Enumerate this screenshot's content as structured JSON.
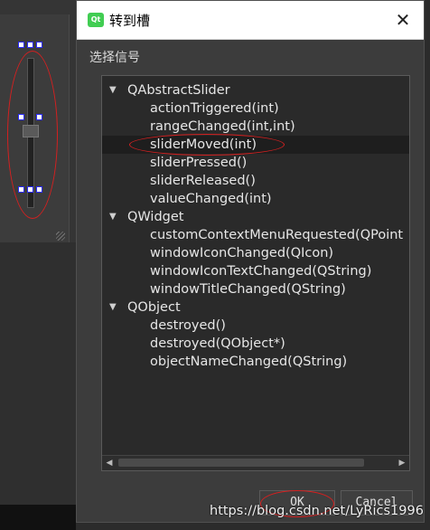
{
  "dialog": {
    "title": "转到槽",
    "icon_text": "Qt",
    "close_glyph": "✕",
    "group_label": "选择信号",
    "tree": [
      {
        "kind": "parent",
        "label": "QAbstractSlider"
      },
      {
        "kind": "child",
        "label": "actionTriggered(int)"
      },
      {
        "kind": "child",
        "label": "rangeChanged(int,int)"
      },
      {
        "kind": "child",
        "label": "sliderMoved(int)",
        "selected": true
      },
      {
        "kind": "child",
        "label": "sliderPressed()"
      },
      {
        "kind": "child",
        "label": "sliderReleased()"
      },
      {
        "kind": "child",
        "label": "valueChanged(int)"
      },
      {
        "kind": "parent",
        "label": "QWidget"
      },
      {
        "kind": "child",
        "label": "customContextMenuRequested(QPoint"
      },
      {
        "kind": "child",
        "label": "windowIconChanged(QIcon)"
      },
      {
        "kind": "child",
        "label": "windowIconTextChanged(QString)"
      },
      {
        "kind": "child",
        "label": "windowTitleChanged(QString)"
      },
      {
        "kind": "parent",
        "label": "QObject"
      },
      {
        "kind": "child",
        "label": "destroyed()"
      },
      {
        "kind": "child",
        "label": "destroyed(QObject*)"
      },
      {
        "kind": "child",
        "label": "objectNameChanged(QString)"
      }
    ],
    "expand_arrow": "▼",
    "scroll_left": "◀",
    "scroll_right": "▶",
    "ok_label": "OK",
    "cancel_label": "Cancel"
  },
  "watermark": "https://blog.csdn.net/LyRics1996",
  "colors": {
    "annotation": "#d42020",
    "selection_handle": "#2a2aff"
  }
}
